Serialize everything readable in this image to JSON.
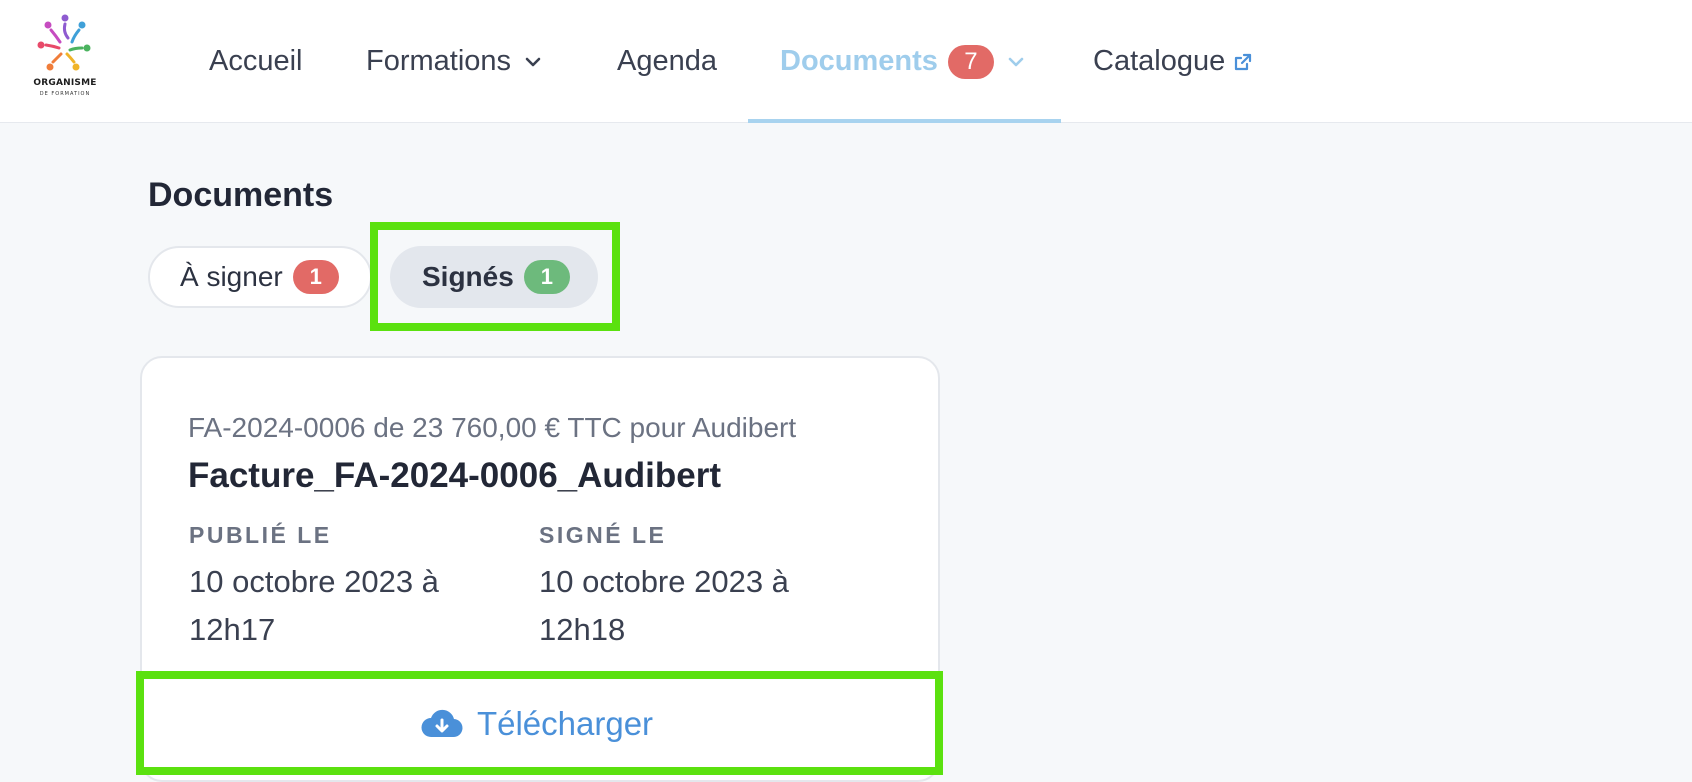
{
  "logo": {
    "title": "ORGANISME",
    "subtitle": "DE FORMATION"
  },
  "nav": {
    "items": [
      {
        "label": "Accueil"
      },
      {
        "label": "Formations"
      },
      {
        "label": "Agenda"
      },
      {
        "label": "Documents",
        "badge": "7"
      },
      {
        "label": "Catalogue"
      }
    ],
    "active": "Documents",
    "active_color": "#9fcdec"
  },
  "page": {
    "title": "Documents"
  },
  "tabs": [
    {
      "label": "À signer",
      "count": "1",
      "badge_color": "#e26a66"
    },
    {
      "label": "Signés",
      "count": "1",
      "badge_color": "#6dba7c",
      "selected": true
    }
  ],
  "document": {
    "subtitle": "FA-2024-0006 de 23 760,00 € TTC pour Audibert",
    "title": "Facture_FA-2024-0006_Audibert",
    "published_label": "PUBLIÉ LE",
    "published_value": "10 octobre 2023 à 12h17",
    "signed_label": "SIGNÉ LE",
    "signed_value": "10 octobre 2023 à 12h18",
    "download_label": "Télécharger",
    "download_icon": "cloud-download-icon"
  },
  "highlight_color": "#5be10f"
}
